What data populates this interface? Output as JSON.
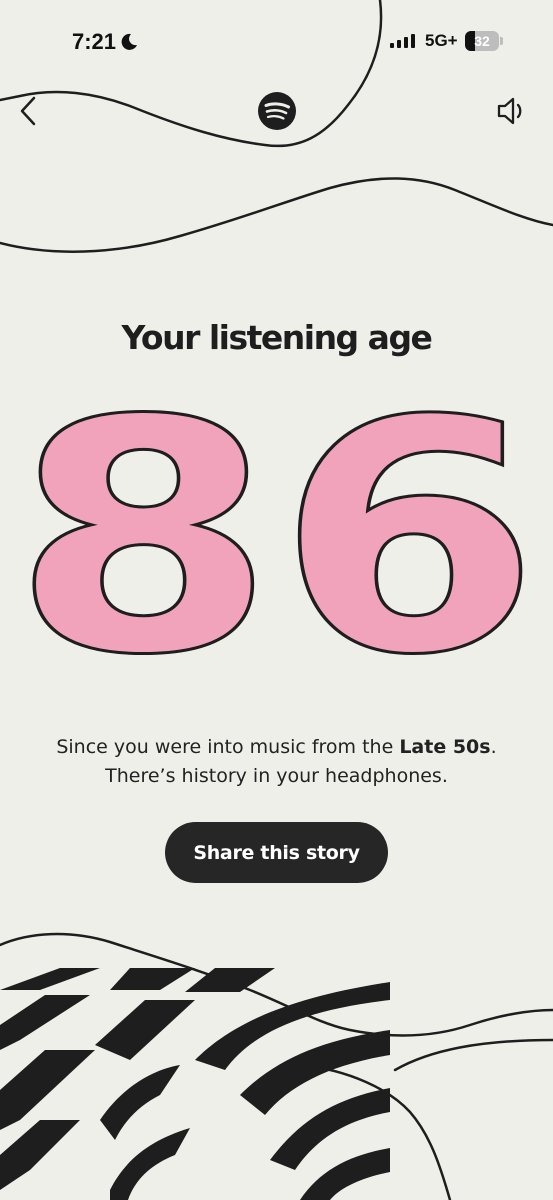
{
  "status_bar": {
    "time": "7:21",
    "network": "5G+",
    "battery_level": "32"
  },
  "header": {
    "back_icon": "chevron-left-icon",
    "logo_icon": "spotify-logo-icon",
    "sound_icon": "speaker-icon"
  },
  "story": {
    "title": "Your listening age",
    "age": "86",
    "age_color": "#f2a3bc",
    "line1_prefix": "Since you were into music from the ",
    "era": "Late 50s",
    "line1_suffix": ".",
    "line2": "There’s history in your headphones.",
    "share_label": "Share this story"
  },
  "colors": {
    "background": "#efefea",
    "ink": "#1e1e1e",
    "button": "#262626"
  }
}
